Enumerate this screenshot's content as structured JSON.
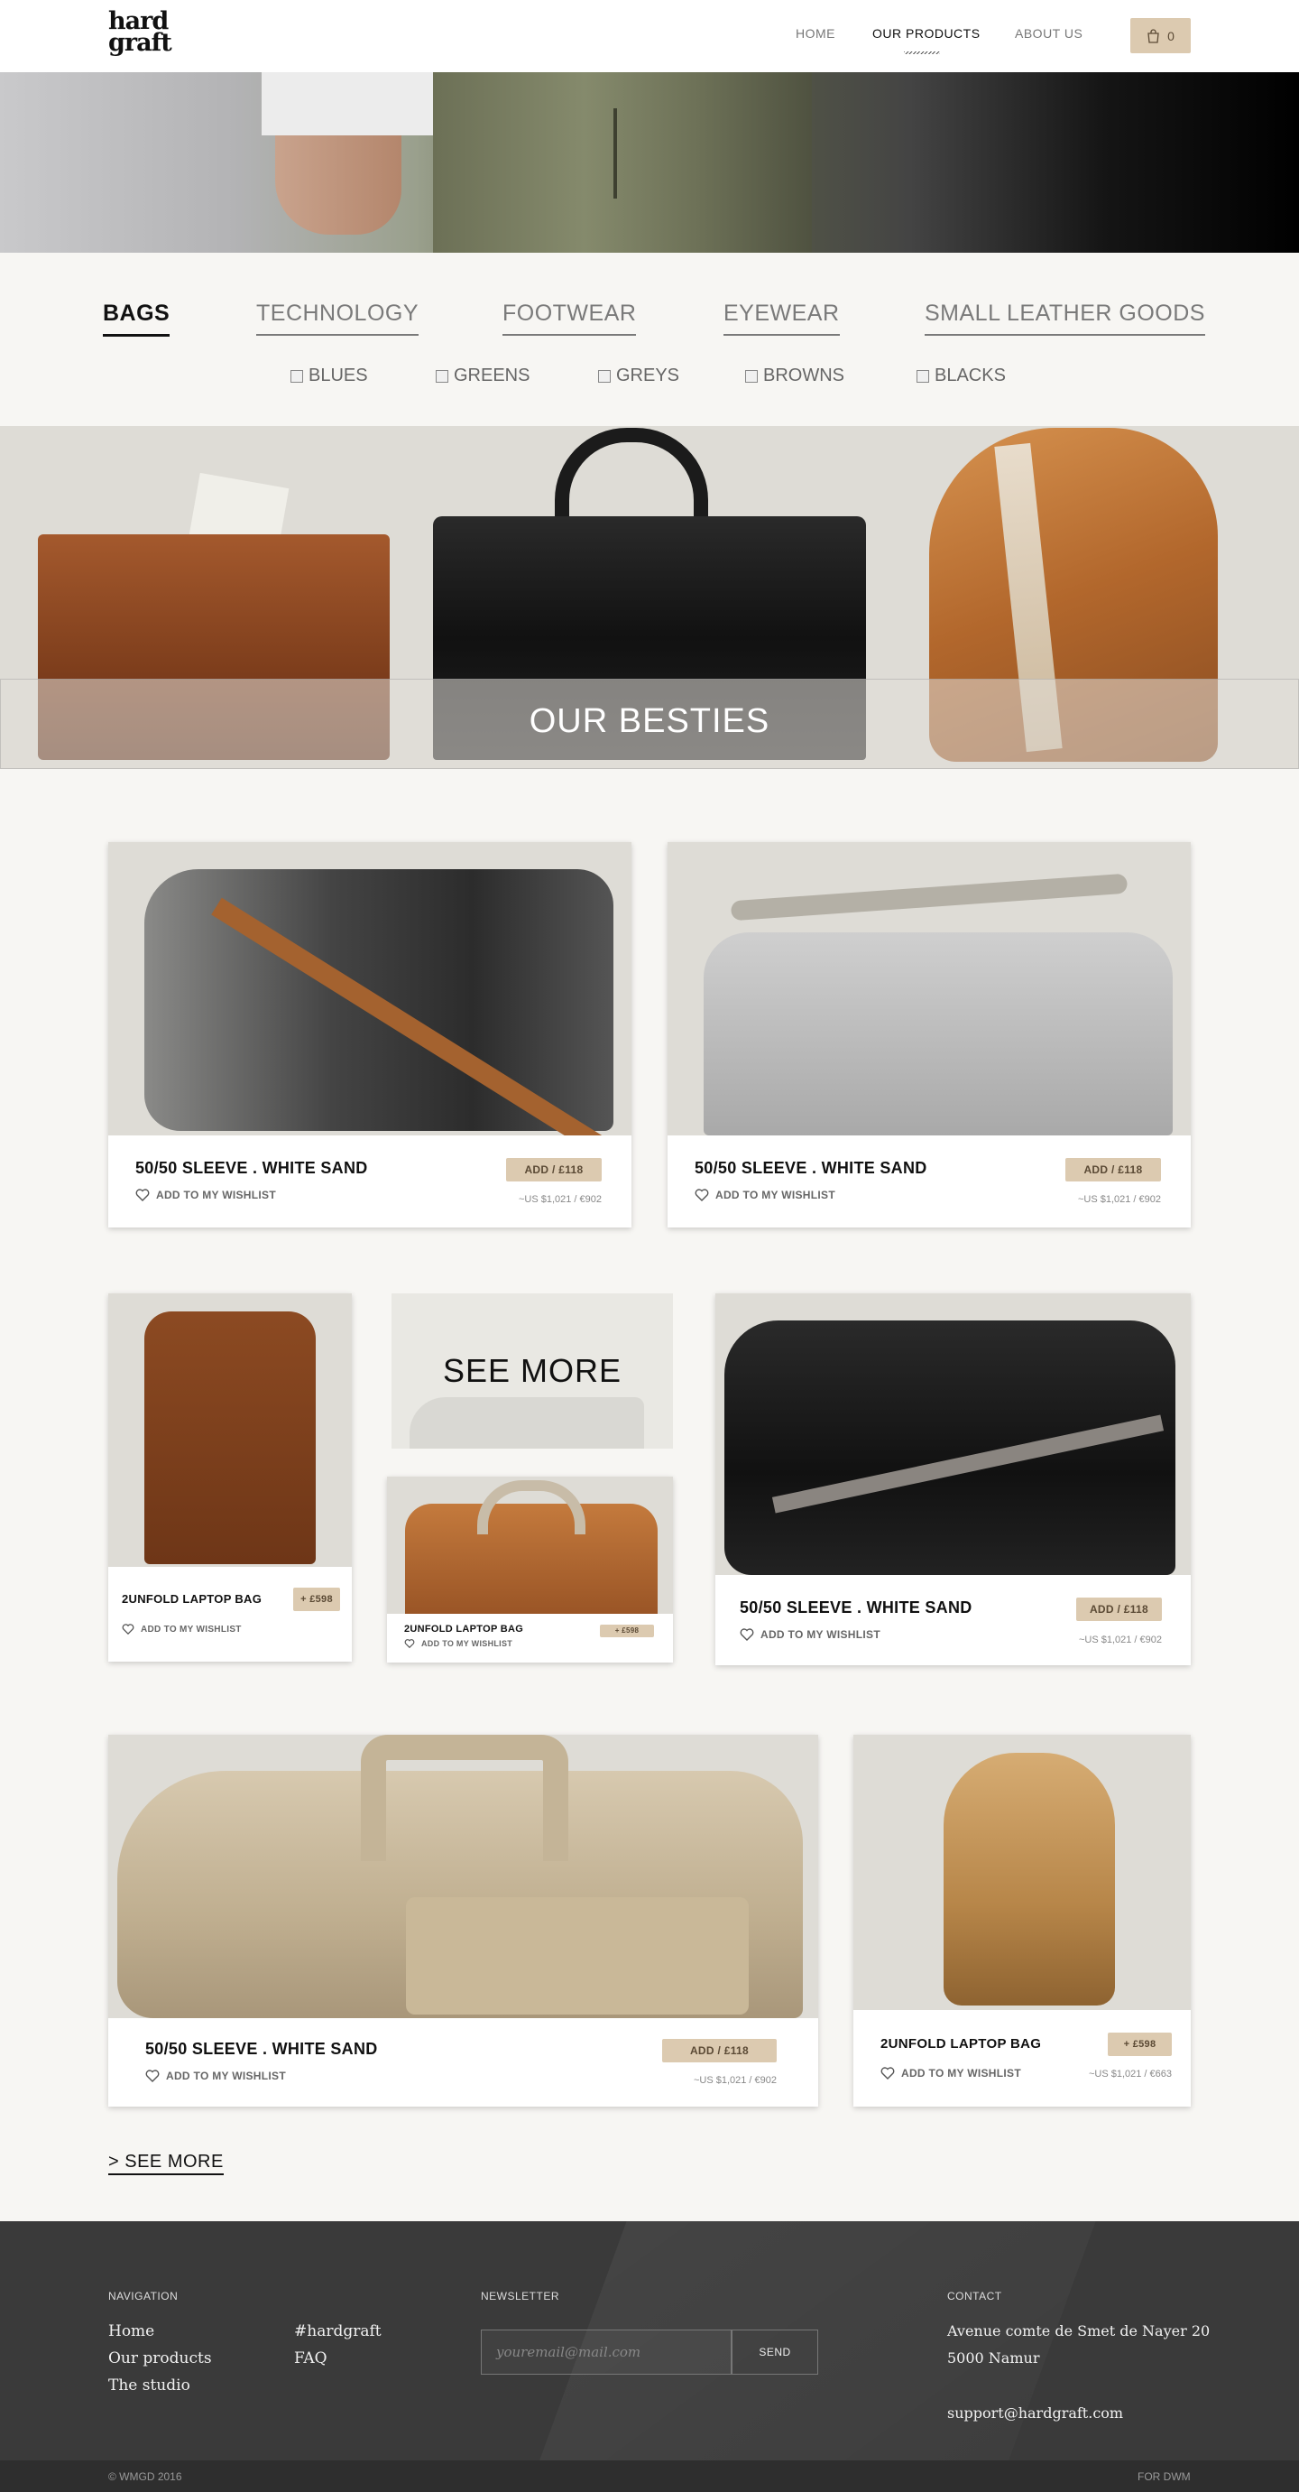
{
  "header": {
    "logo_line1": "hard",
    "logo_line2": "graft",
    "nav": [
      "Home",
      "Our Products",
      "About Us"
    ],
    "active_nav": "Our Products",
    "cart_count": "0"
  },
  "categories": [
    "Bags",
    "Technology",
    "Footwear",
    "Eyewear",
    "Small Leather Goods"
  ],
  "active_category": "Bags",
  "filters": [
    "Blues",
    "Greens",
    "Greys",
    "Browns",
    "Blacks"
  ],
  "besties": {
    "title": "Our Besties"
  },
  "products": [
    {
      "name": "50/50 Sleeve . White Sand",
      "wishlist": "Add to my wishlist",
      "price": "ADD / £118",
      "conversion": "~US $1,021 / €902"
    },
    {
      "name": "50/50 Sleeve . White Sand",
      "wishlist": "Add to my wishlist",
      "price": "ADD / £118",
      "conversion": "~US $1,021 / €902"
    },
    {
      "name": "2Unfold Laptop Bag",
      "wishlist": "Add to my wishlist",
      "price": "+ £598"
    },
    {
      "name": "2Unfold Laptop Bag",
      "wishlist": "Add to my wishlist",
      "price": "+ £598"
    },
    {
      "name": "50/50 Sleeve . White Sand",
      "wishlist": "Add to my wishlist",
      "price": "ADD / £118",
      "conversion": "~US $1,021 / €902"
    },
    {
      "name": "50/50 Sleeve . White Sand",
      "wishlist": "Add to my wishlist",
      "price": "ADD / £118",
      "conversion": "~US $1,021 / €902"
    },
    {
      "name": "2Unfold Laptop Bag",
      "wishlist": "Add to my wishlist",
      "price": "+ £598",
      "conversion": "~US $1,021 / €663"
    }
  ],
  "see_more_tile": "See More",
  "see_more_link": "> See More",
  "footer": {
    "navigation_heading": "Navigation",
    "nav_links": [
      "Home",
      "Our products",
      "The studio"
    ],
    "nav_links2": [
      "#hardgraft",
      "FAQ"
    ],
    "newsletter_heading": "Newsletter",
    "newsletter_placeholder": "youremail@mail.com",
    "send_label": "Send",
    "contact_heading": "Contact",
    "address_line1": "Avenue comte de Smet de Nayer 20",
    "address_line2": "5000 Namur",
    "email": "support@hardgraft.com",
    "copyright": "© WMGD 2016",
    "credit": "For DWM"
  },
  "colors": {
    "accent": "#dccab0",
    "accent_text": "#5b4a35",
    "footer_bg": "#3a3a3a",
    "page_bg": "#f7f6f3"
  }
}
